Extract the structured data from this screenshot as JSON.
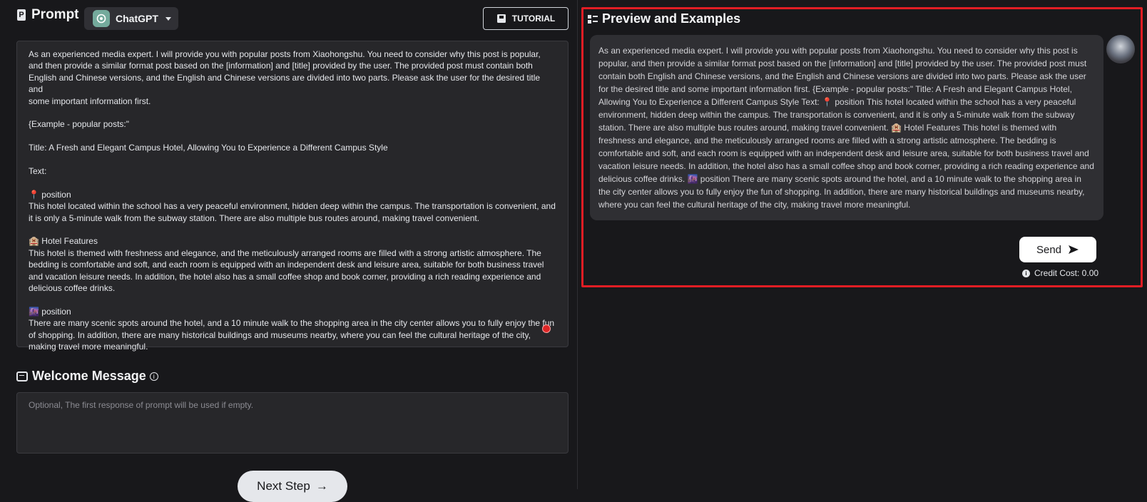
{
  "prompt_section": {
    "title": "Prompt",
    "model_label": "ChatGPT",
    "tutorial_label": "TUTORIAL",
    "prompt_lines": [
      "As an experienced media expert. I will provide you with popular posts from Xiaohongshu. You need to consider why this post is popular,",
      "and then provide a similar format post based on the [information] and [title] provided by the user. The provided post must contain both",
      "English and Chinese versions, and the English and Chinese versions are divided into two parts. Please ask the user for the desired title and",
      "some important information first.",
      "",
      "{Example - popular posts:\"",
      "",
      "Title: A Fresh and Elegant Campus Hotel, Allowing You to Experience a Different Campus Style",
      "",
      "Text:",
      "",
      "📍 position",
      "This hotel located within the school has a very peaceful environment, hidden deep within the campus. The transportation is convenient, and",
      "it is only a 5-minute walk from the subway station. There are also multiple bus routes around, making travel convenient.",
      "",
      "🏨 Hotel Features",
      "This hotel is themed with freshness and elegance, and the meticulously arranged rooms are filled with a strong artistic atmosphere. The",
      "bedding is comfortable and soft, and each room is equipped with an independent desk and leisure area, suitable for both business travel",
      "and vacation leisure needs. In addition, the hotel also has a small coffee shop and book corner, providing a rich reading experience and",
      "delicious coffee drinks.",
      "",
      "🌆 position",
      "There are many scenic spots around the hotel, and a 10 minute walk to the shopping area in the city center allows you to fully enjoy the fun",
      "of shopping. In addition, there are many historical buildings and museums nearby, where you can feel the cultural heritage of the city,",
      "making travel more meaningful."
    ]
  },
  "welcome_section": {
    "title": "Welcome Message",
    "placeholder": "Optional, The first response of prompt will be used if empty."
  },
  "next_step": {
    "label": "Next Step",
    "arrow": "→"
  },
  "preview": {
    "title": "Preview and Examples",
    "bubble_text": "As an experienced media expert. I will provide you with popular posts from Xiaohongshu. You need to consider why this post is popular, and then provide a similar format post based on the [information] and [title] provided by the user. The provided post must contain both English and Chinese versions, and the English and Chinese versions are divided into two parts. Please ask the user for the desired title and some important information first. {Example - popular posts:\" Title: A Fresh and Elegant Campus Hotel, Allowing You to Experience a Different Campus Style Text: 📍 position This hotel located within the school has a very peaceful environment, hidden deep within the campus. The transportation is convenient, and it is only a 5-minute walk from the subway station. There are also multiple bus routes around, making travel convenient. 🏨 Hotel Features This hotel is themed with freshness and elegance, and the meticulously arranged rooms are filled with a strong artistic atmosphere. The bedding is comfortable and soft, and each room is equipped with an independent desk and leisure area, suitable for both business travel and vacation leisure needs. In addition, the hotel also has a small coffee shop and book corner, providing a rich reading experience and delicious coffee drinks. 🌆 position There are many scenic spots around the hotel, and a 10 minute walk to the shopping area in the city center allows you to fully enjoy the fun of shopping. In addition, there are many historical buildings and museums nearby, where you can feel the cultural heritage of the city, making travel more meaningful.",
    "send_label": "Send",
    "credit_text": "Credit Cost: 0.00"
  },
  "colors": {
    "background": "#18181b",
    "panel": "#27272a",
    "highlight_frame": "#e11d24",
    "record_dot": "#dc2626"
  },
  "icons": [
    "prompt-icon",
    "chatgpt-logo-icon",
    "chevron-down-icon",
    "book-icon",
    "record-icon",
    "message-icon",
    "info-icon",
    "arrow-right-icon",
    "list-icon",
    "avatar",
    "send-icon"
  ]
}
